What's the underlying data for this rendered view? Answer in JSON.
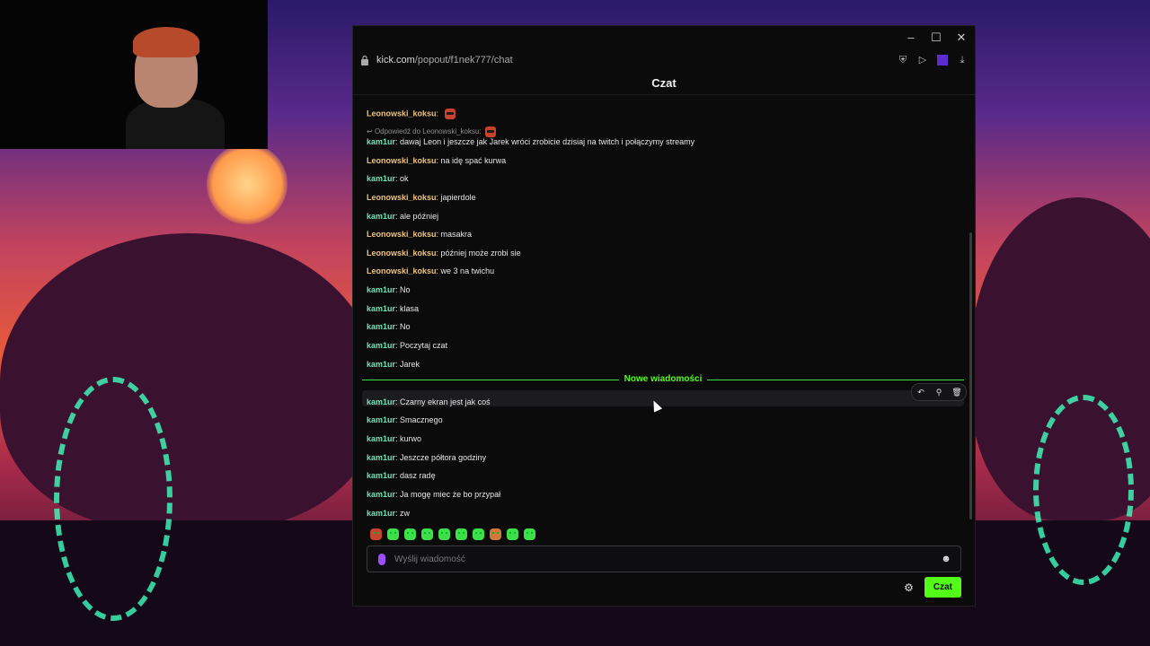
{
  "window": {
    "url_host": "kick.com",
    "url_path": "/popout/f1nek777/chat",
    "minimize_icon": "minimize-icon",
    "maximize_icon": "maximize-icon",
    "close_icon": "close-icon"
  },
  "chat": {
    "title": "Czat",
    "reply_text": "Odpowiedź do Leonowski_koksu:",
    "messages_top": [
      {
        "user": "Leonowski_koksu",
        "type": "leon",
        "text": ""
      },
      {
        "user": "kam1ur",
        "type": "kam",
        "text": "dawaj Leon i jeszcze jak Jarek wróci zrobicie dzisiaj na twitch i połączymy streamy"
      },
      {
        "user": "Leonowski_koksu",
        "type": "leon",
        "text": "na idę spać kurwa"
      },
      {
        "user": "kam1ur",
        "type": "kam",
        "text": "ok"
      },
      {
        "user": "Leonowski_koksu",
        "type": "leon",
        "text": "japierdole"
      },
      {
        "user": "kam1ur",
        "type": "kam",
        "text": "ale później"
      },
      {
        "user": "Leonowski_koksu",
        "type": "leon",
        "text": "masakra"
      },
      {
        "user": "Leonowski_koksu",
        "type": "leon",
        "text": "później może zrobi sie"
      },
      {
        "user": "Leonowski_koksu",
        "type": "leon",
        "text": "we 3 na twichu"
      },
      {
        "user": "kam1ur",
        "type": "kam",
        "text": "No"
      },
      {
        "user": "kam1ur",
        "type": "kam",
        "text": "klasa"
      },
      {
        "user": "kam1ur",
        "type": "kam",
        "text": "No"
      },
      {
        "user": "kam1ur",
        "type": "kam",
        "text": "Poczytaj czat"
      },
      {
        "user": "kam1ur",
        "type": "kam",
        "text": "Jarek"
      }
    ],
    "new_messages_label": "Nowe wiadomości",
    "messages_new": [
      {
        "user": "kam1ur",
        "type": "kam",
        "text": "Czarny ekran jest jak coś"
      },
      {
        "user": "kam1ur",
        "type": "kam",
        "text": "Smacznego"
      },
      {
        "user": "kam1ur",
        "type": "kam",
        "text": "kurwo"
      },
      {
        "user": "kam1ur",
        "type": "kam",
        "text": "Jeszcze półtora godziny"
      },
      {
        "user": "kam1ur",
        "type": "kam",
        "text": "dasz radę"
      },
      {
        "user": "kam1ur",
        "type": "kam",
        "text": "Ja mogę miec że bo przypał"
      },
      {
        "user": "kam1ur",
        "type": "kam",
        "text": "zw"
      }
    ],
    "input_placeholder": "Wyślij wiadomość",
    "send_label": "Czat",
    "accent_color": "#53fc18"
  }
}
